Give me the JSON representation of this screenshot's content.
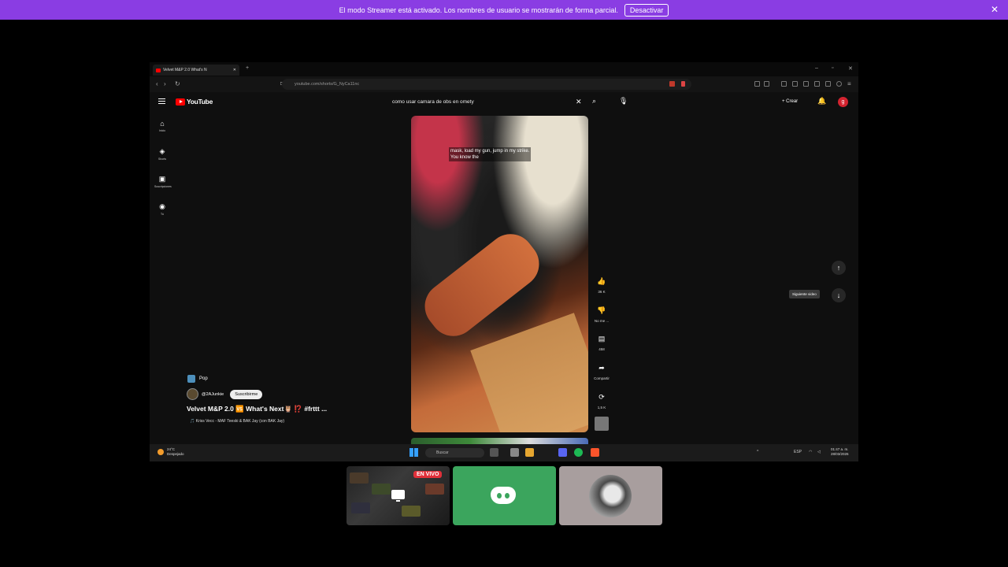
{
  "banner": {
    "message": "El modo Streamer está activado. Los nombres de usuario se mostrarán de forma parcial.",
    "button": "Desactivar"
  },
  "browser": {
    "tab_title": "Velvet M&P 2.0 What's N",
    "url": "youtube.com/shorts/G_NyCa11nc"
  },
  "youtube": {
    "logo": "YouTube",
    "search_query": "como usar camara de  obs en omety",
    "create_label": "Crear",
    "avatar_letter": "g",
    "sidebar": [
      {
        "label": "Inicio",
        "icon": "home-icon"
      },
      {
        "label": "Shorts",
        "icon": "shorts-icon"
      },
      {
        "label": "Suscripciones",
        "icon": "subscriptions-icon"
      },
      {
        "label": "Tú",
        "icon": "you-icon"
      }
    ],
    "short": {
      "caption_line1": "mask, load my gun, jump in my strike.",
      "caption_line2": "You know the",
      "category": "Pop",
      "channel": "@2AJunkie",
      "subscribe": "Suscribirme",
      "title": "Velvet M&P 2.0 🆚 What's Next🦉 ⁉️ #frttt ...",
      "song": "🎵 Kriss Vecc - MAF Teeski & BAK Jay (con BAK Jay)"
    },
    "actions": {
      "likes": "36 K",
      "dislike": "No me ...",
      "comments": "458",
      "share": "Compartir",
      "remix": "1,5 K"
    },
    "next_tooltip": "Siguiente video"
  },
  "taskbar": {
    "temp": "24°C",
    "weather": "Despejado",
    "search": "Buscar",
    "lang": "ESP",
    "time": "01:47 a. m.",
    "date": "28/03/2026"
  },
  "stream": {
    "live_badge": "EN VIVO"
  },
  "colors": {
    "banner": "#8a3de3",
    "youtube_red": "#ff0000",
    "discord_green": "#3ba55d",
    "live_red": "#e0303a"
  }
}
